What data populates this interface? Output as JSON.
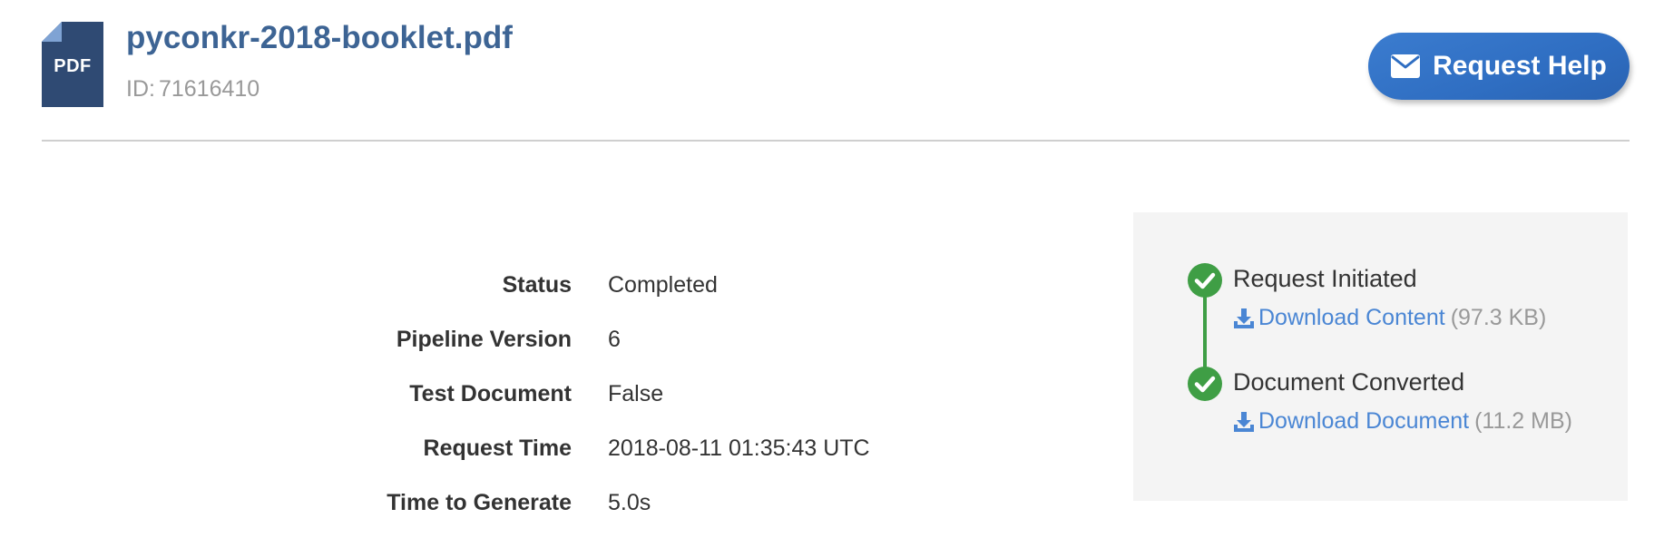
{
  "header": {
    "file_type_label": "PDF",
    "file_name": "pyconkr-2018-booklet.pdf",
    "id_label": "ID:",
    "id_value": "71616410",
    "help_button_label": "Request Help"
  },
  "details": [
    {
      "label": "Status",
      "value": "Completed"
    },
    {
      "label": "Pipeline Version",
      "value": "6"
    },
    {
      "label": "Test Document",
      "value": "False"
    },
    {
      "label": "Request Time",
      "value": "2018-08-11 01:35:43 UTC"
    },
    {
      "label": "Time to Generate",
      "value": "5.0s"
    }
  ],
  "timeline": {
    "steps": [
      {
        "title": "Request Initiated",
        "link_label": "Download Content",
        "size": "(97.3 KB)",
        "icon": "check-circle-icon",
        "link_icon": "download-icon"
      },
      {
        "title": "Document Converted",
        "link_label": "Download Document",
        "size": "(11.2 MB)",
        "icon": "check-circle-icon",
        "link_icon": "download-icon"
      }
    ]
  },
  "colors": {
    "accent_blue": "#2f6ec2",
    "title_blue": "#3d6494",
    "link_blue": "#4a86d4",
    "success_green": "#3f9e45",
    "muted_gray": "#999999",
    "panel_background": "#f4f4f4",
    "pdf_icon": "#2f4a73"
  }
}
